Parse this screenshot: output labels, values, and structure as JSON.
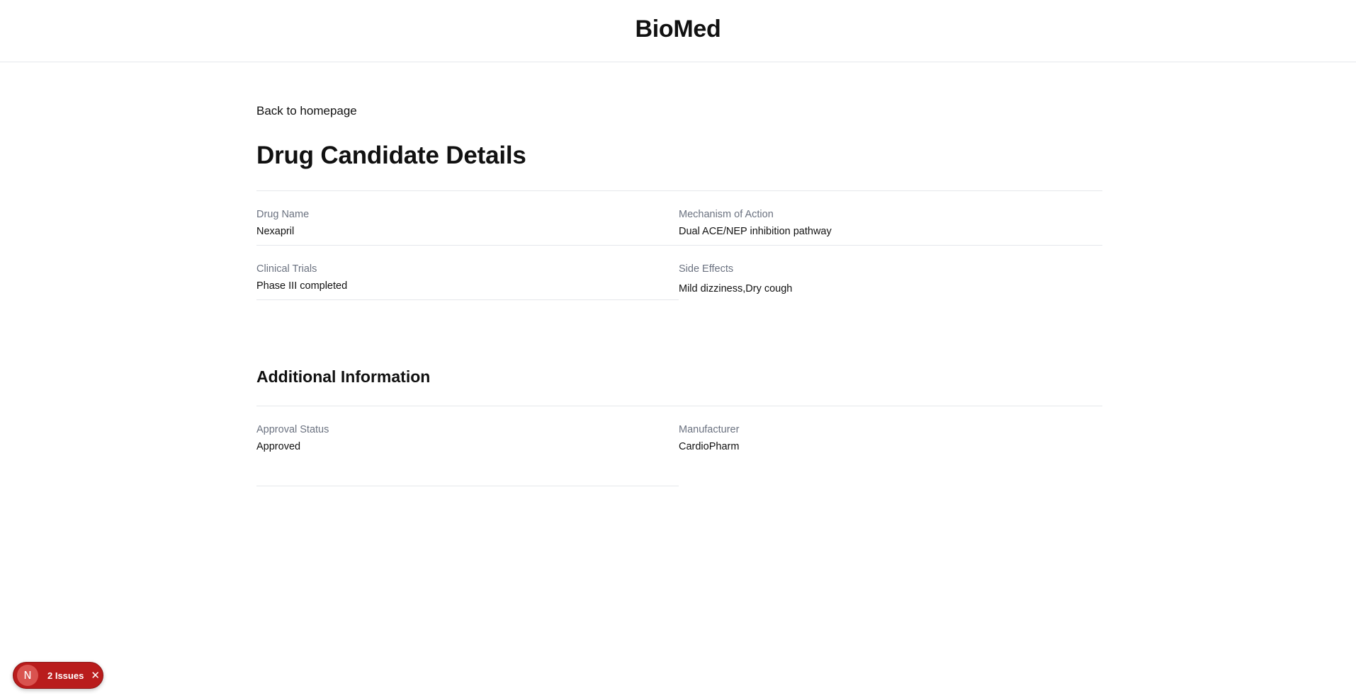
{
  "header": {
    "title": "BioMed"
  },
  "nav": {
    "back_label": "Back to homepage"
  },
  "page": {
    "title": "Drug Candidate Details"
  },
  "details": [
    {
      "label": "Drug Name",
      "value": "Nexapril"
    },
    {
      "label": "Mechanism of Action",
      "value": "Dual ACE/NEP inhibition pathway"
    },
    {
      "label": "Clinical Trials",
      "value": "Phase III completed"
    },
    {
      "label": "Side Effects",
      "value": "Mild dizziness,Dry cough"
    }
  ],
  "additional": {
    "title": "Additional Information",
    "fields": [
      {
        "label": "Approval Status",
        "value": "Approved"
      },
      {
        "label": "Manufacturer",
        "value": "CardioPharm"
      }
    ]
  },
  "dev_overlay": {
    "avatar_letter": "N",
    "issues_label": "2 Issues",
    "close_glyph": "✕",
    "color": "#b91c1c"
  }
}
